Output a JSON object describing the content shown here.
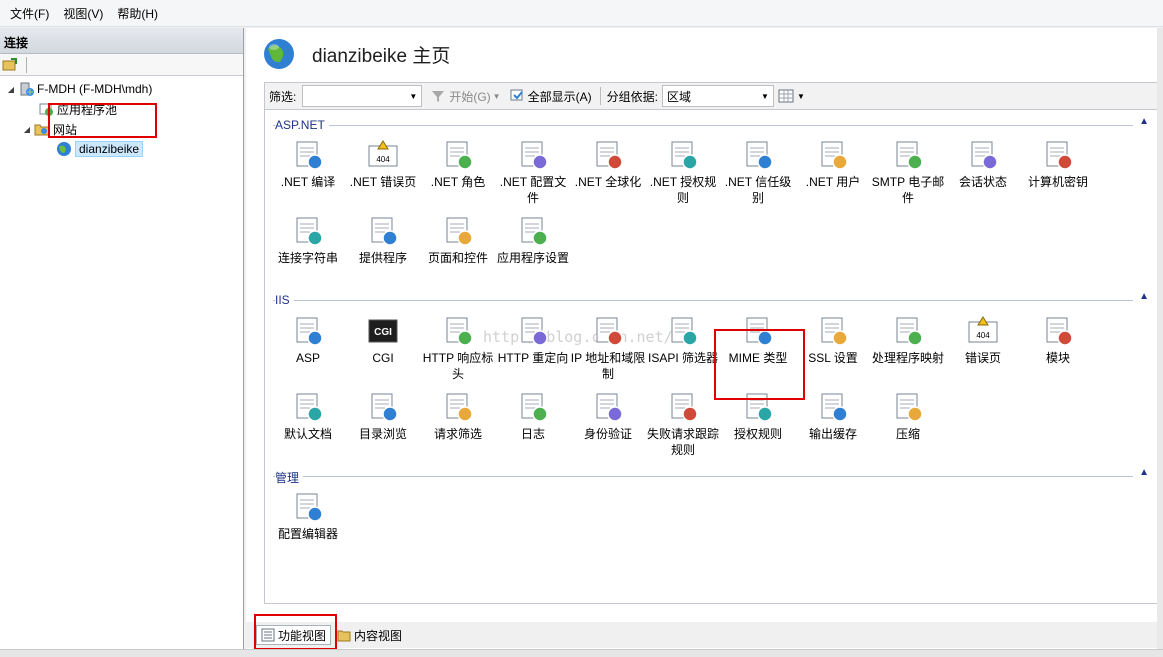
{
  "menu": [
    "文件(F)",
    "视图(V)",
    "帮助(H)"
  ],
  "connections": {
    "title": "连接",
    "tree": [
      {
        "label": "F-MDH (F-MDH\\mdh)",
        "level": 0,
        "expanded": true
      },
      {
        "label": "应用程序池",
        "level": 1
      },
      {
        "label": "网站",
        "level": 1,
        "expanded": true
      },
      {
        "label": "dianzibeike",
        "level": 2,
        "selected": true
      }
    ]
  },
  "page": {
    "title": "dianzibeike 主页"
  },
  "filter": {
    "label": "筛选:",
    "value": "",
    "start": "开始(G)",
    "show_all": "全部显示(A)",
    "group_by_label": "分组依据:",
    "group_by_value": "区域"
  },
  "groups": {
    "aspnet": "ASP.NET",
    "iis": "IIS",
    "manage": "管理"
  },
  "features_aspnet": [
    ".NET 编译",
    ".NET 错误页",
    ".NET 角色",
    ".NET 配置文件",
    ".NET 全球化",
    ".NET 授权规则",
    ".NET 信任级别",
    ".NET 用户",
    "SMTP 电子邮件",
    "会话状态",
    "计算机密钥",
    "连接字符串",
    "提供程序",
    "页面和控件",
    "应用程序设置"
  ],
  "features_iis": [
    "ASP",
    "CGI",
    "HTTP 响应标头",
    "HTTP 重定向",
    "IP 地址和域限制",
    "ISAPI 筛选器",
    "MIME 类型",
    "SSL 设置",
    "处理程序映射",
    "错误页",
    "模块",
    "默认文档",
    "目录浏览",
    "请求筛选",
    "日志",
    "身份验证",
    "失败请求跟踪规则",
    "授权规则",
    "输出缓存",
    "压缩"
  ],
  "features_manage": [
    "配置编辑器"
  ],
  "icons": {
    "cgi_text": "CGI",
    "err_text": "404"
  },
  "view_tabs": [
    "功能视图",
    "内容视图"
  ],
  "watermark": "http://blog.csdn.net/",
  "colors": {
    "accent": "#1e3287",
    "highlight": "#e00000",
    "selection": "#cce8ff"
  }
}
